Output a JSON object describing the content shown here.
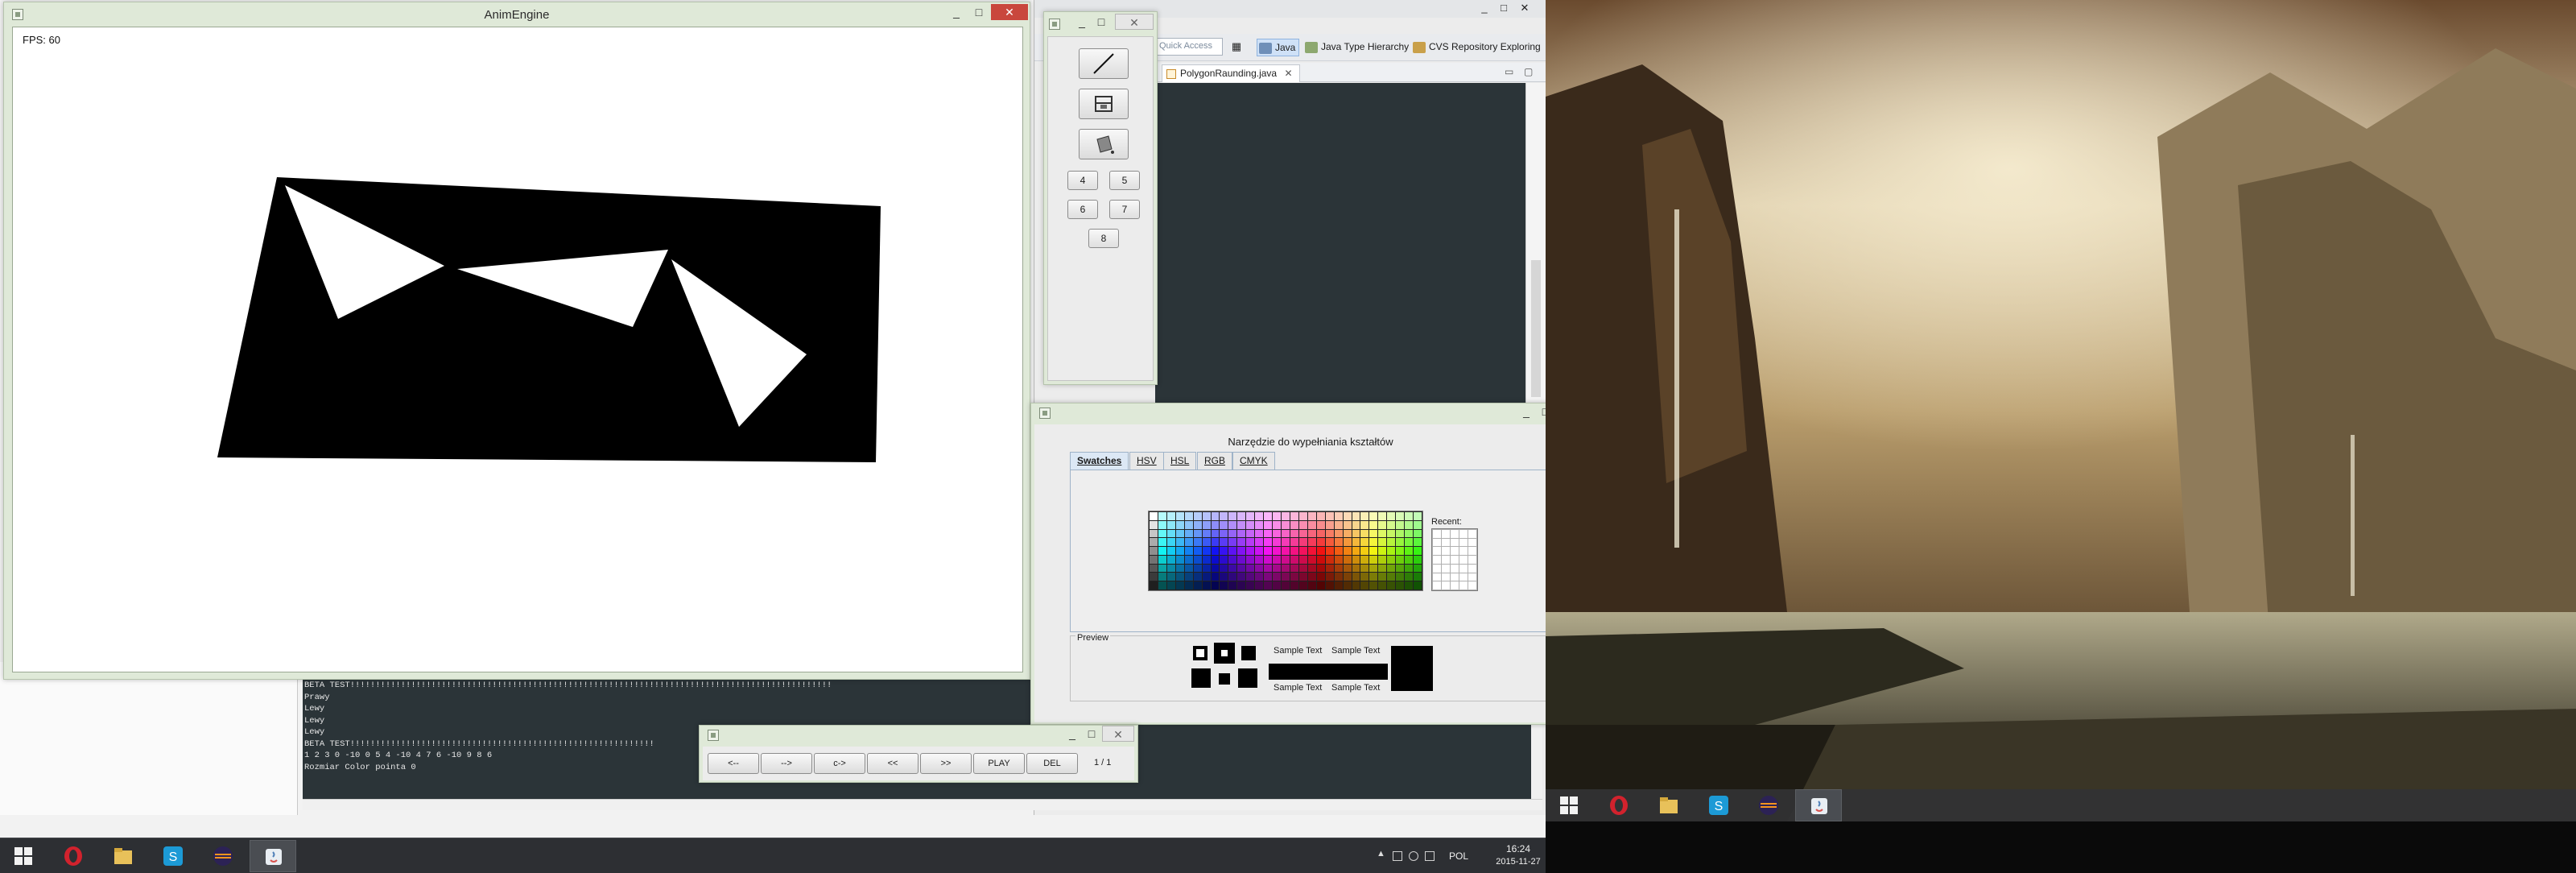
{
  "anim_window": {
    "title": "AnimEngine",
    "fps_label": "FPS: 60",
    "controls": {
      "minimize": "_",
      "maximize": "□",
      "close": "✕"
    }
  },
  "eclipse": {
    "quick_access_placeholder": "Quick Access",
    "perspectives": [
      "Java",
      "Java Type Hierarchy",
      "CVS Repository Exploring"
    ],
    "editor_tab": "PolygonRaunding.java",
    "console_lines": [
      "BETA TEST!!!!!!!!!!!!!!!!!!!!!!!!!!!!!!!!!!!!!!!!!!!!!!!!!!!!!!!!!!!!!!!!!!!!!!!!!!!!!!!!!!!!!!!!!!!!!!!",
      "Prawy",
      "Lewy",
      "Lewy",
      "Lewy",
      "BETA TEST!!!!!!!!!!!!!!!!!!!!!!!!!!!!!!!!!!!!!!!!!!!!!!!!!!!!!!!!!!!!",
      "1 2 3 0 -10 0 5 4 -10 4 7 6 -10 9 8 6",
      "Rozmiar Color pointa 0"
    ]
  },
  "tools_window": {
    "tools": [
      "line-tool-icon",
      "fill-tool-icon",
      "bucket-tool-icon"
    ],
    "number_buttons": [
      "4",
      "5",
      "6",
      "7",
      "8"
    ]
  },
  "chooser": {
    "heading": "Narzędzie do wypełniania kształtów",
    "tabs": [
      "Swatches",
      "HSV",
      "HSL",
      "RGB",
      "CMYK"
    ],
    "active_tab": "Swatches",
    "recent_label": "Recent:",
    "preview_label": "Preview",
    "sample_text": "Sample Text"
  },
  "player": {
    "buttons": [
      "<--",
      "-->",
      "c->",
      "<<",
      ">>",
      "PLAY",
      "DEL"
    ],
    "page": "1 / 1"
  },
  "taskbar": {
    "apps": [
      "start-icon",
      "opera-icon",
      "explorer-icon",
      "skype-icon",
      "eclipse-icon",
      "java-icon"
    ],
    "language": "POL",
    "time": "16:24",
    "date": "2015-11-27"
  },
  "colors": {
    "window_frame": "#dfe9d8",
    "close_button": "#c9473d",
    "console_bg": "#2b3438",
    "taskbar_bg": "#2d2f33"
  }
}
